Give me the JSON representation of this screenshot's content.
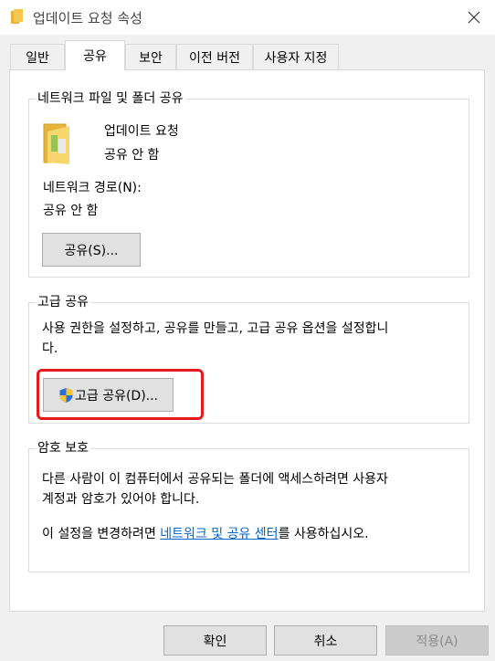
{
  "window": {
    "title": "업데이트 요청 속성"
  },
  "tabs": [
    {
      "label": "일반"
    },
    {
      "label": "공유"
    },
    {
      "label": "보안"
    },
    {
      "label": "이전 버전"
    },
    {
      "label": "사용자 지정"
    }
  ],
  "network_share": {
    "group_title": "네트워크 파일 및 폴더 공유",
    "folder_name": "업데이트 요청",
    "share_status": "공유 안 함",
    "path_label": "네트워크 경로(N):",
    "path_value": "공유 안 함",
    "share_button": "공유(S)..."
  },
  "advanced_share": {
    "group_title": "고급 공유",
    "description_line1": "사용 권한을 설정하고, 공유를 만들고, 고급 공유 옵션을 설정합니",
    "description_line2": "다.",
    "button": "고급 공유(D)..."
  },
  "password": {
    "group_title": "암호 보호",
    "description_line1": "다른 사람이 이 컴퓨터에서 공유되는 폴더에 액세스하려면 사용자",
    "description_line2": "계정과 암호가 있어야 합니다.",
    "line3_prefix": "이 설정을 변경하려면 ",
    "line3_link": "네트워크 및 공유 센터",
    "line3_suffix": "를 사용하십시오."
  },
  "footer": {
    "ok": "확인",
    "cancel": "취소",
    "apply": "적용(A)"
  },
  "colors": {
    "highlight": "#e51a1a",
    "link": "#0066cc",
    "folder": "#f5c74c"
  }
}
